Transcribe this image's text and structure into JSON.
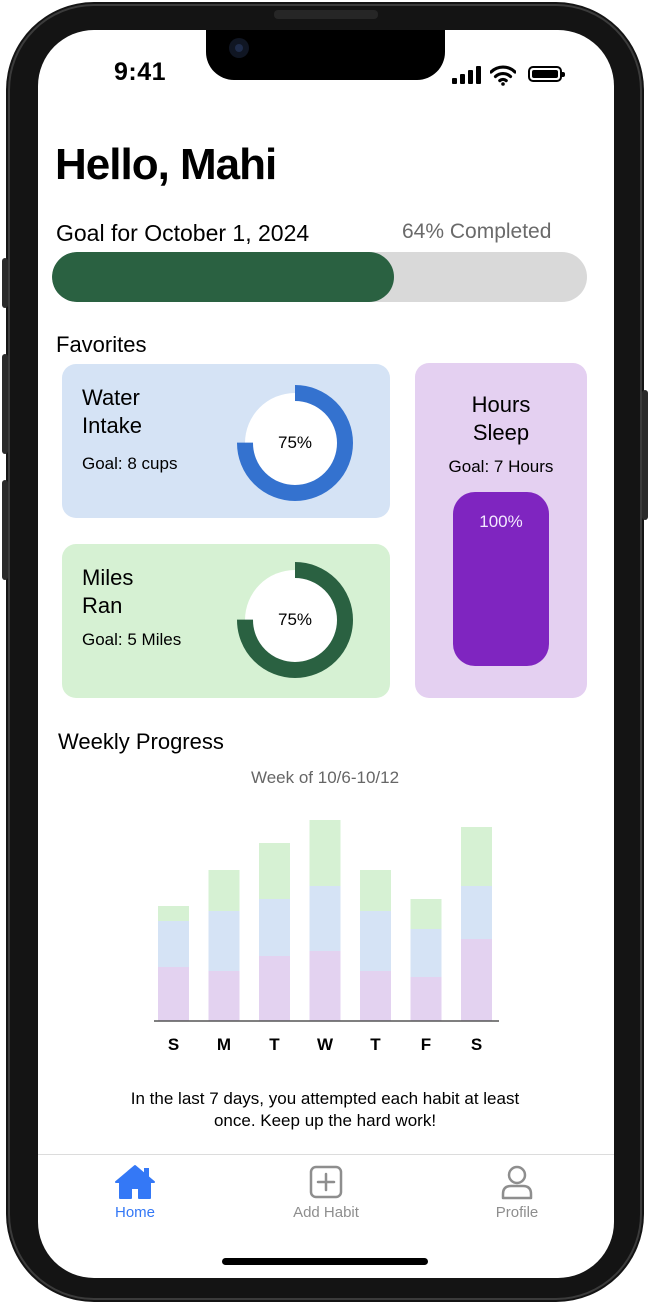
{
  "status_bar": {
    "time": "9:41"
  },
  "header": {
    "greeting": "Hello, Mahi"
  },
  "daily_goal": {
    "title": "Goal for October 1, 2024",
    "completed_text": "64% Completed",
    "progress": 0.64,
    "fill_color": "#2a6141",
    "track_color": "#d9d9d9"
  },
  "favorites": {
    "heading": "Favorites",
    "water": {
      "title_line1": "Water",
      "title_line2": "Intake",
      "goal": "Goal: 8 cups",
      "percent_label": "75%",
      "progress": 0.75,
      "card_color": "#d5e3f5",
      "ring_color": "#3472cf"
    },
    "miles": {
      "title_line1": "Miles",
      "title_line2": "Ran",
      "goal": "Goal: 5 Miles",
      "percent_label": "75%",
      "progress": 0.75,
      "card_color": "#d6f1d3",
      "ring_color": "#2a6141"
    },
    "sleep": {
      "title_line1": "Hours",
      "title_line2": "Sleep",
      "goal": "Goal: 7 Hours",
      "percent_label": "100%",
      "progress": 1.0,
      "card_color": "#e4d0f1",
      "bar_color": "#7f25c0"
    }
  },
  "weekly": {
    "heading": "Weekly Progress",
    "subheading": "Week of 10/6-10/12",
    "summary": "In the last 7 days, you attempted each habit at least once. Keep up the hard work!"
  },
  "chart_data": {
    "type": "bar",
    "stacked": true,
    "categories": [
      "S",
      "M",
      "T",
      "W",
      "T",
      "F",
      "S"
    ],
    "series": [
      {
        "values": [
          54,
          50,
          65,
          70,
          50,
          44,
          82
        ],
        "color": "#e3d2f0"
      },
      {
        "values": [
          46,
          60,
          57,
          65,
          60,
          48,
          53
        ],
        "color": "#d5e3f5"
      },
      {
        "values": [
          15,
          41,
          56,
          66,
          41,
          30,
          59
        ],
        "color": "#d6f1d3"
      }
    ],
    "ylim": [
      0,
      200
    ],
    "grid": false
  },
  "tabbar": {
    "tabs": [
      {
        "label": "Home",
        "icon": "home-icon",
        "active": true
      },
      {
        "label": "Add Habit",
        "icon": "plus-square-icon",
        "active": false
      },
      {
        "label": "Profile",
        "icon": "person-icon",
        "active": false
      }
    ],
    "active_color": "#3478f6",
    "inactive_color": "#8e8e8e"
  }
}
